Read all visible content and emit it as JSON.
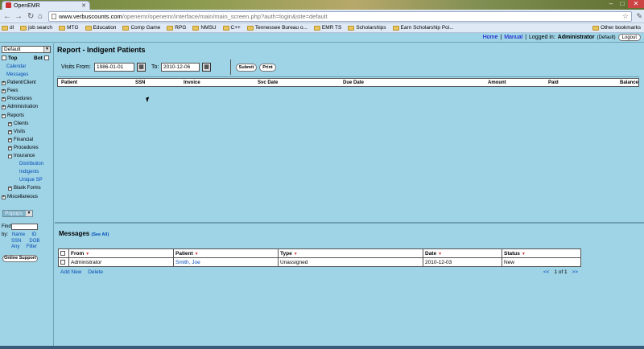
{
  "browser": {
    "tab_title": "OpenEMR",
    "url_domain": "www.verbuscounts.com",
    "url_path": "/openemr/openemr/interface/main/main_screen.php?auth=login&site=default",
    "bookmarks": [
      "dl",
      "job search",
      "MTG",
      "Education",
      "Comp Game",
      "RPG",
      "NMSU",
      "C++",
      "Tennessee Bureau o...",
      "EMR TS",
      "Scholarships",
      "Earn Scholarship Poi..."
    ],
    "other_bookmarks": "Other bookmarks"
  },
  "header": {
    "home": "Home",
    "manual": "Manual",
    "logged_in": "Logged in:",
    "user": "Administrator",
    "facility": "(Default)",
    "logout": "Logout",
    "sep": "|"
  },
  "nav": {
    "select_value": "Default",
    "top": "Top",
    "bot": "Bot",
    "items": [
      {
        "label": "Calendar",
        "kind": "link"
      },
      {
        "label": "Messages",
        "kind": "link"
      },
      {
        "label": "Patient/Client",
        "kind": "group"
      },
      {
        "label": "Fees",
        "kind": "group"
      },
      {
        "label": "Procedures",
        "kind": "group"
      },
      {
        "label": "Administration",
        "kind": "group"
      },
      {
        "label": "Reports",
        "kind": "group"
      },
      {
        "label": "Clients",
        "kind": "sub"
      },
      {
        "label": "Visits",
        "kind": "sub"
      },
      {
        "label": "Financial",
        "kind": "sub"
      },
      {
        "label": "Procedures",
        "kind": "sub"
      },
      {
        "label": "Insurance",
        "kind": "sub"
      },
      {
        "label": "Distribution",
        "kind": "subsub"
      },
      {
        "label": "Indigents",
        "kind": "subsub"
      },
      {
        "label": "Unique SP",
        "kind": "subsub"
      },
      {
        "label": "Blank Forms",
        "kind": "sub"
      },
      {
        "label": "Miscellaneous",
        "kind": "group"
      }
    ],
    "popups": "Popups",
    "find_label": "Find:",
    "by_label": "by:",
    "by_name": "Name",
    "by_id": "ID",
    "by_ssn": "SSN",
    "by_dob": "DOB",
    "by_any": "Any",
    "by_filter": "Filter",
    "online_support": "Online Support"
  },
  "report": {
    "title": "Report - Indigent Patients",
    "visits_from_label": "Visits From:",
    "from_date": "1986-01-01",
    "to_label": "To:",
    "to_date": "2010-12-06",
    "submit": "Submit",
    "print": "Print",
    "columns": [
      "Patient",
      "SSN",
      "Invoice",
      "Svc Date",
      "Due Date",
      "Amount",
      "Paid",
      "Balance"
    ]
  },
  "messages": {
    "title": "Messages",
    "see_all": "(See All)",
    "columns": [
      "From",
      "Patient",
      "Type",
      "Date",
      "Status"
    ],
    "rows": [
      {
        "from": "Administrator",
        "patient": "Smith, Joe",
        "type": "Unassigned",
        "date": "2010-12-03",
        "status": "New"
      }
    ],
    "add_new": "Add New",
    "delete": "Delete",
    "pager_prev": "<<",
    "pager_text": "1 of 1",
    "pager_next": ">>"
  }
}
